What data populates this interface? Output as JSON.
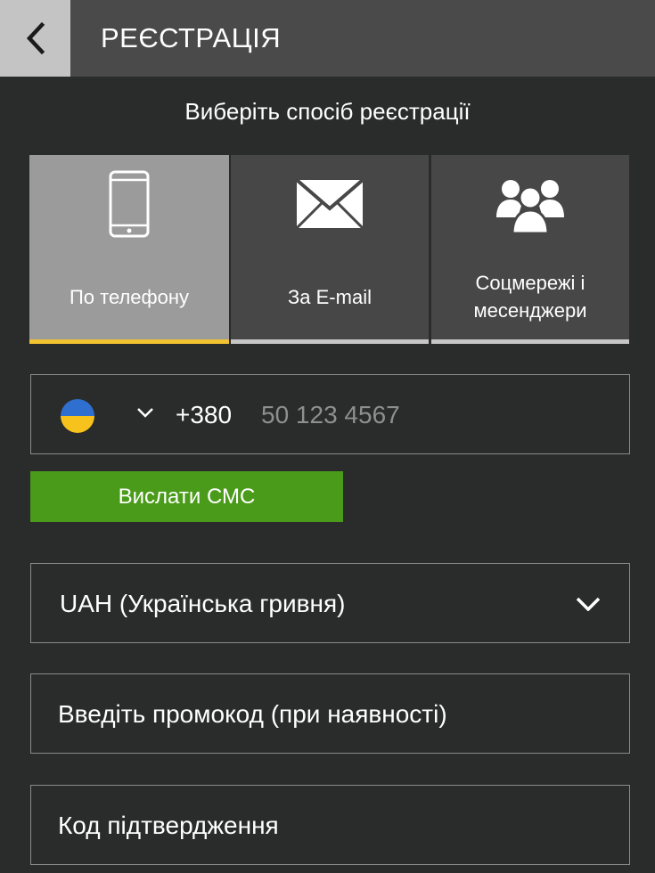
{
  "header": {
    "back_icon": "chevron-left-icon",
    "title": "РЕЄСТРАЦІЯ"
  },
  "subtitle": "Виберіть спосіб реєстрації",
  "methods": [
    {
      "label": "По телефону",
      "icon": "smartphone-icon",
      "active": true
    },
    {
      "label": "За E-mail",
      "icon": "envelope-icon",
      "active": false
    },
    {
      "label": "Соцмережі і месенджери",
      "icon": "users-group-icon",
      "active": false
    }
  ],
  "phone": {
    "flag": "ukraine-flag-icon",
    "country_code": "+380",
    "placeholder": "50 123 4567",
    "value": ""
  },
  "sms_button_label": "Вислати СМС",
  "currency": {
    "selected": "UAH (Українська гривня)"
  },
  "promo": {
    "placeholder": "Введіть промокод (при наявності)"
  },
  "confirmation": {
    "placeholder": "Код підтвердження"
  },
  "colors": {
    "background": "#2a2b2b",
    "header": "#4a4a4a",
    "back_button": "#c4c4c4",
    "tile": "#474747",
    "tile_active": "#9b9b9b",
    "active_indicator": "#f2c230",
    "sms_button": "#4b9b1b"
  }
}
